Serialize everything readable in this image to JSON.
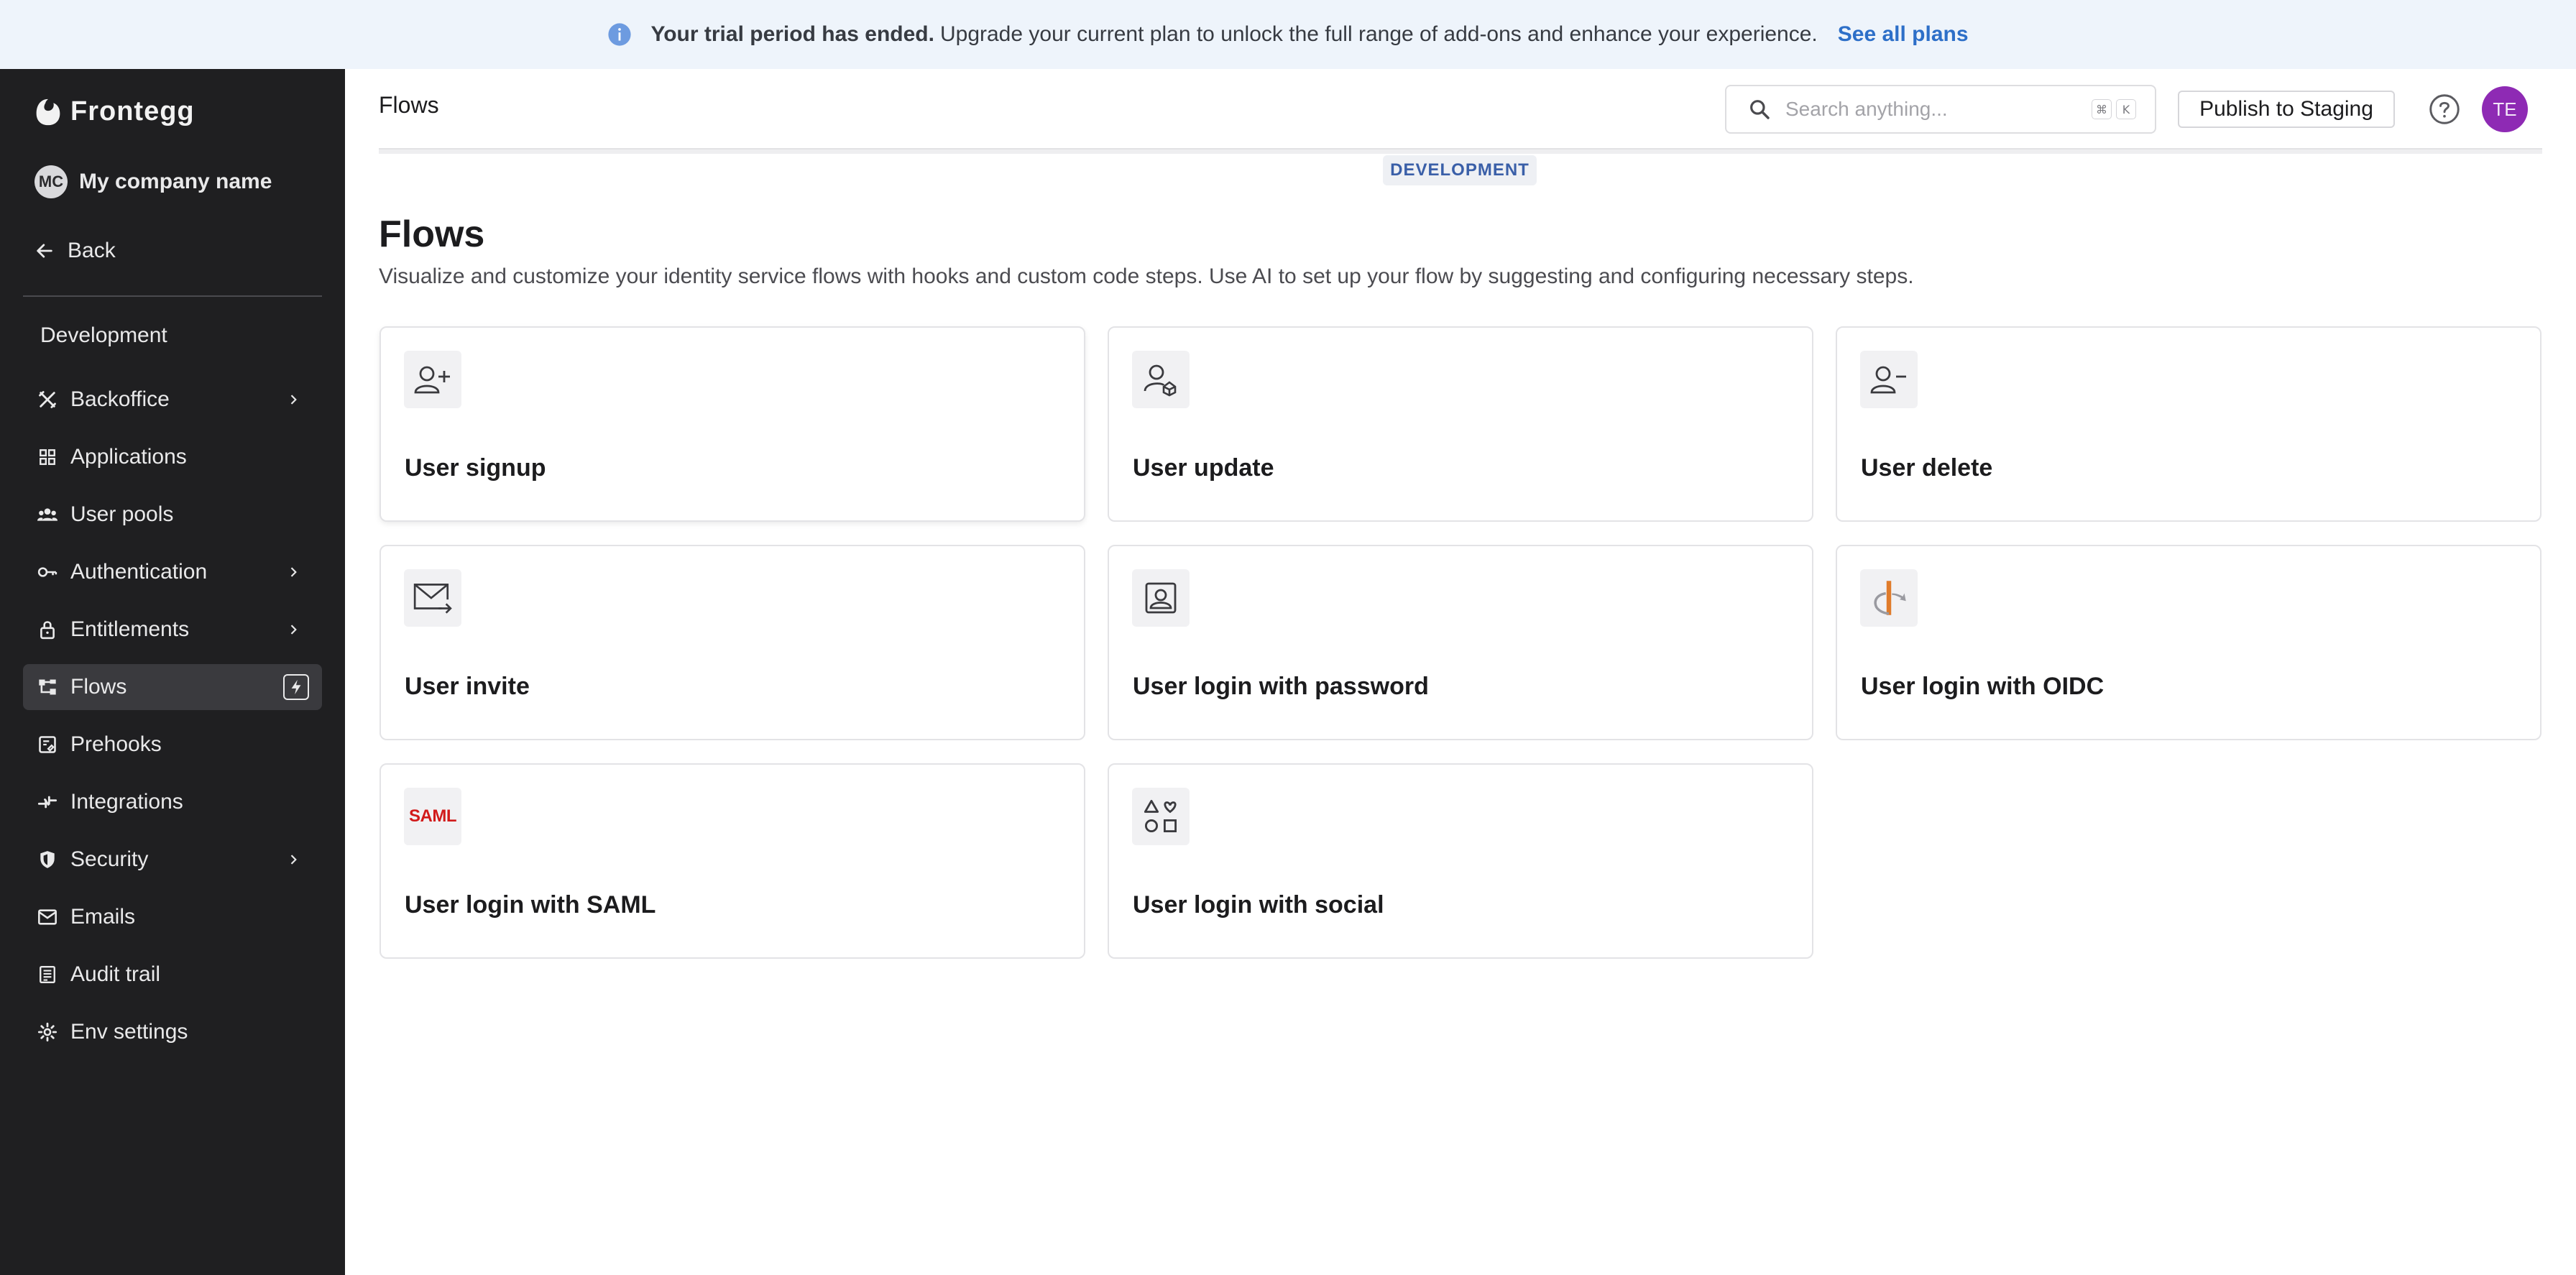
{
  "banner": {
    "bold_text": "Your trial period has ended.",
    "text": "Upgrade your current plan to unlock the full range of add-ons and enhance your experience.",
    "link_label": "See all plans"
  },
  "sidebar": {
    "logo_text": "Frontegg",
    "company_initials": "MC",
    "company_name": "My company name",
    "back_label": "Back",
    "section_title": "Development",
    "items": [
      {
        "label": "Backoffice",
        "icon": "tools-icon",
        "has_chevron": true
      },
      {
        "label": "Applications",
        "icon": "grid-icon",
        "has_chevron": false
      },
      {
        "label": "User pools",
        "icon": "users-icon",
        "has_chevron": false
      },
      {
        "label": "Authentication",
        "icon": "key-icon",
        "has_chevron": true
      },
      {
        "label": "Entitlements",
        "icon": "lock-icon",
        "has_chevron": true
      },
      {
        "label": "Flows",
        "icon": "flows-icon",
        "has_chevron": false,
        "active": true
      },
      {
        "label": "Prehooks",
        "icon": "prehooks-icon",
        "has_chevron": false
      },
      {
        "label": "Integrations",
        "icon": "integrations-icon",
        "has_chevron": false
      },
      {
        "label": "Security",
        "icon": "shield-icon",
        "has_chevron": true
      },
      {
        "label": "Emails",
        "icon": "mail-icon",
        "has_chevron": false
      },
      {
        "label": "Audit trail",
        "icon": "list-icon",
        "has_chevron": false
      },
      {
        "label": "Env settings",
        "icon": "gear-icon",
        "has_chevron": false
      }
    ]
  },
  "header": {
    "title": "Flows",
    "search_placeholder": "Search anything...",
    "shortcut_keys": [
      "⌘",
      "K"
    ],
    "publish_label": "Publish to Staging",
    "user_initials": "TE"
  },
  "environment_badge": "DEVELOPMENT",
  "main": {
    "title": "Flows",
    "description": "Visualize and customize your identity service flows with hooks and custom code steps. Use AI to set up your flow by suggesting and configuring necessary steps.",
    "cards": [
      {
        "title": "User signup",
        "icon": "user-plus-icon"
      },
      {
        "title": "User update",
        "icon": "user-update-icon"
      },
      {
        "title": "User delete",
        "icon": "user-minus-icon"
      },
      {
        "title": "User invite",
        "icon": "mail-invite-icon"
      },
      {
        "title": "User login with password",
        "icon": "user-card-icon"
      },
      {
        "title": "User login with OIDC",
        "icon": "openid-icon"
      },
      {
        "title": "User login with SAML",
        "icon": "saml-icon",
        "icon_text": "SAML"
      },
      {
        "title": "User login with social",
        "icon": "shapes-icon"
      }
    ]
  },
  "colors": {
    "banner_bg": "#eef4fb",
    "link": "#2d6fc8",
    "sidebar_bg": "#1f1f21",
    "avatar": "#8e2ab4",
    "saml_red": "#d11a1a",
    "oidc_orange": "#e07b2a"
  }
}
